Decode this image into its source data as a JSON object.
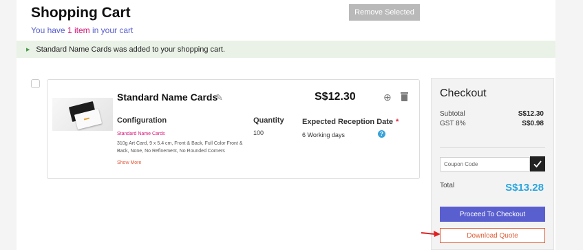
{
  "header": {
    "title": "Shopping Cart",
    "subtitle_prefix": "You have ",
    "subtitle_count": "1 item",
    "subtitle_suffix": " in your cart",
    "remove_selected_label": "Remove Selected"
  },
  "notification": {
    "message": "Standard Name Cards was added to your shopping cart."
  },
  "cart_item": {
    "name": "Standard Name Cards",
    "price": "S$12.30",
    "configuration_heading": "Configuration",
    "configuration_name": "Standard Name Cards",
    "configuration_details": "310g Art Card, 9 x 5.4 cm, Front & Back, Full Color Front & Back, None, No Refinement, No Rounded Corners",
    "show_more_label": "Show More",
    "quantity_heading": "Quantity",
    "quantity_value": "100",
    "reception_heading": "Expected Reception Date",
    "reception_required_mark": "*",
    "reception_value": "6 Working days",
    "help_glyph": "?",
    "icons": [
      "edit-icon",
      "duplicate-icon",
      "trash-icon",
      "help-icon"
    ]
  },
  "checkout": {
    "title": "Checkout",
    "subtotal_label": "Subtotal",
    "subtotal_value": "S$12.30",
    "gst_label": "GST 8%",
    "gst_value": "S$0.98",
    "coupon_placeholder": "Coupon Code",
    "total_label": "Total",
    "total_value": "S$13.28",
    "proceed_label": "Proceed To Checkout",
    "download_label": "Download Quote"
  },
  "colors": {
    "accent_purple": "#5a5fcf",
    "total_blue": "#2aa6df",
    "download_orange": "#e0603a",
    "banner_green_bg": "#eaf2e7",
    "annotation_arrow": "#e02020"
  }
}
